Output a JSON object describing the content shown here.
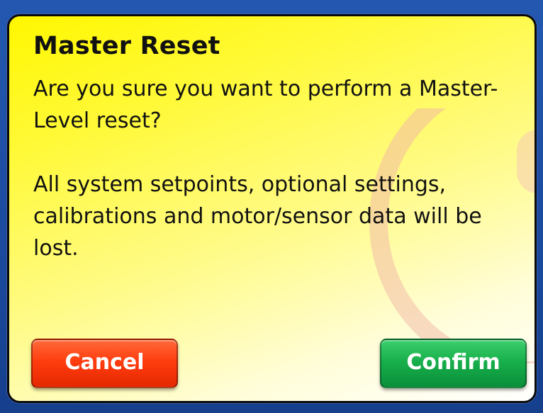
{
  "dialog": {
    "title": "Master Reset",
    "message_line1": "Are you sure you want to perform a Master-Level reset?",
    "message_line2": "All system setpoints, optional settings, calibrations and motor/sensor data will be lost.",
    "cancel_label": "Cancel",
    "confirm_label": "Confirm"
  },
  "colors": {
    "background": "#1a4aa0",
    "dialog_top": "#fff700",
    "cancel": "#ff3d0f",
    "confirm": "#18b04c"
  },
  "icons": {
    "watermark": "info-watermark-icon"
  }
}
